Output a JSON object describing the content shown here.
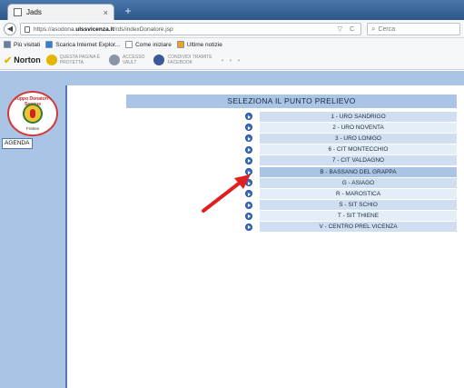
{
  "browser": {
    "tab_title": "Jads",
    "tab_close": "×",
    "new_tab": "+",
    "url_prefix": "https://asodona.",
    "url_domain": "ulssvicenza.it",
    "url_path": "/rds/indexDonatore.jsp",
    "url_icons": "▽ C",
    "search_placeholder": "Cerca",
    "bookmarks": [
      {
        "label": "Più visitati",
        "icon": "gear-icon"
      },
      {
        "label": "Scarica Internet Explor...",
        "icon": "ie-icon"
      },
      {
        "label": "Come iniziare",
        "icon": "page-icon"
      },
      {
        "label": "Ultime notizie",
        "icon": "rss-icon"
      }
    ],
    "norton_label": "Norton",
    "toolbar_items": [
      {
        "line1": "Questa pagina è",
        "line2": "protetta",
        "icon": "shield-check-icon"
      },
      {
        "line1": "Accesso",
        "line2": "Vault",
        "icon": "vault-icon"
      },
      {
        "line1": "Condividi tramite",
        "line2": "Facebook",
        "icon": "facebook-icon"
      }
    ],
    "toolbar_dots": "• • •"
  },
  "sidebar": {
    "logo_top": "Gruppo Donatori di Sangue",
    "logo_bottom": "Fratres",
    "agenda_label": "AGENDA"
  },
  "main": {
    "header": "SELEZIONA IL PUNTO PRELIEVO",
    "sites": [
      "1 - URO SANDRIGO",
      "2 - URO NOVENTA",
      "3 - URO LONIGO",
      "6 - CIT MONTECCHIO",
      "7 - CIT VALDAGNO",
      "B - BASSANO DEL GRAPPA",
      "G - ASIAGO",
      "R - MAROSTICA",
      "S - SIT SCHIO",
      "T - SIT THIENE",
      "V - CENTRO PREL VICENZA"
    ],
    "highlighted_index": 5
  },
  "colors": {
    "band": "#a9c4e4",
    "row_odd": "#cfdff1",
    "row_even": "#e4eef9",
    "arrow": "#e02020",
    "sidebar_border": "#4d79b5"
  }
}
